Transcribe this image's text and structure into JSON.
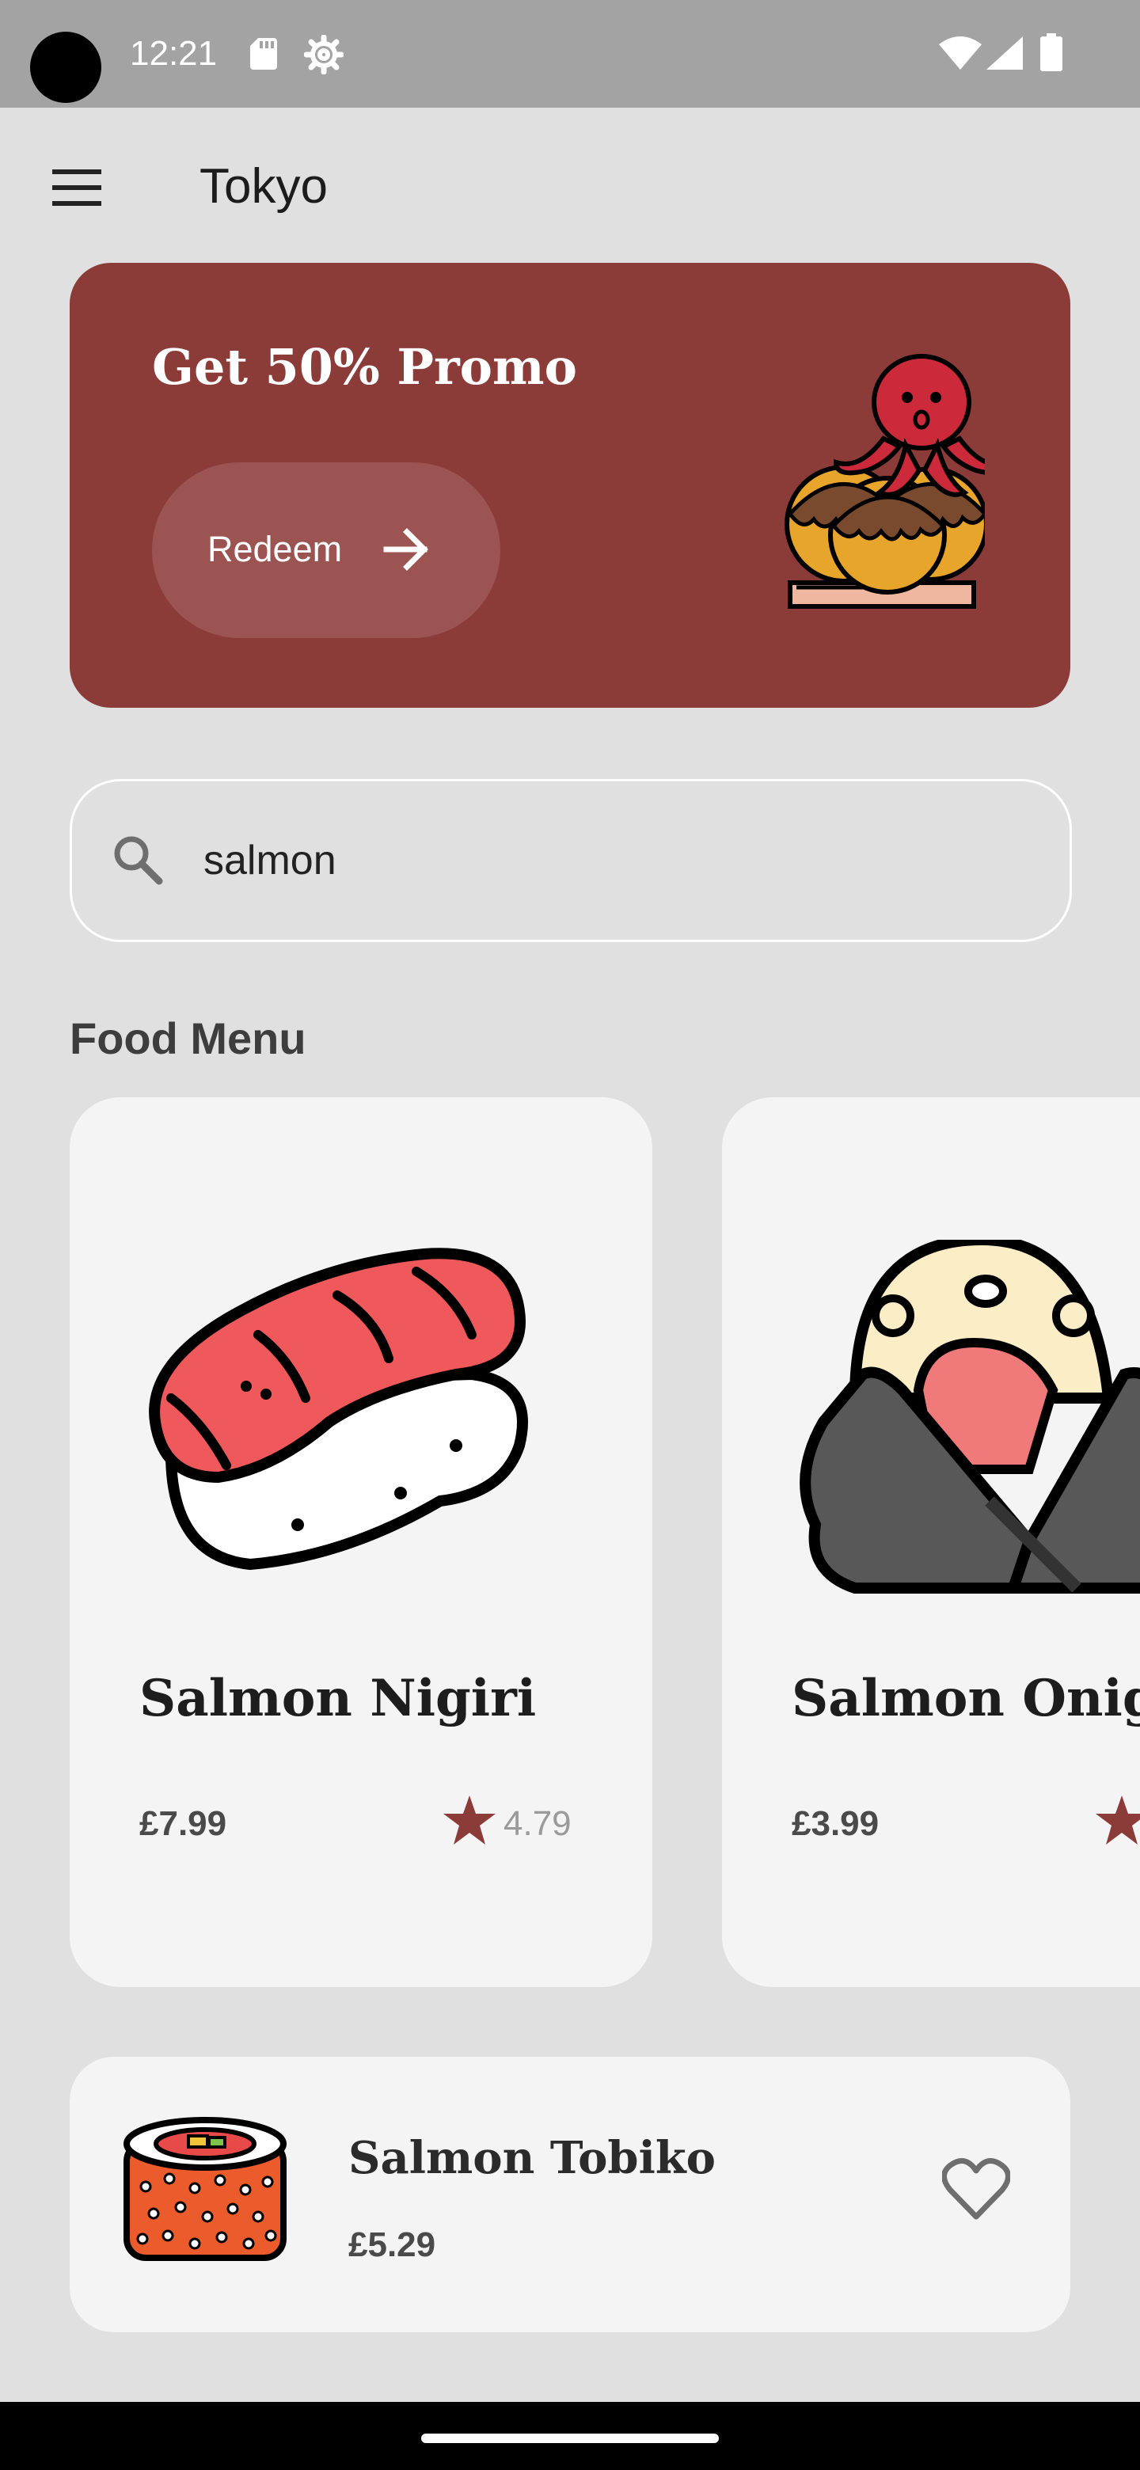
{
  "status_bar": {
    "time": "12:21"
  },
  "header": {
    "title": "Tokyo"
  },
  "promo": {
    "title": "Get 50% Promo",
    "button_label": "Redeem"
  },
  "search": {
    "value": "salmon"
  },
  "food_menu": {
    "title": "Food Menu",
    "cards": [
      {
        "name": "Salmon Nigiri",
        "price": "£7.99",
        "rating": "4.79"
      },
      {
        "name": "Salmon Onigiri",
        "price": "£3.99",
        "rating": ""
      }
    ]
  },
  "list": [
    {
      "name": "Salmon Tobiko",
      "price": "£5.29"
    }
  ],
  "colors": {
    "accent": "#8b3c39",
    "background": "#e0e0e0",
    "card": "#f4f4f4",
    "star": "#8b3c39"
  },
  "icons": [
    "menu-icon",
    "arrow-right-icon",
    "search-icon",
    "star-icon",
    "heart-icon",
    "wifi-icon",
    "signal-icon",
    "battery-icon",
    "sd-card-icon",
    "gear-icon"
  ]
}
